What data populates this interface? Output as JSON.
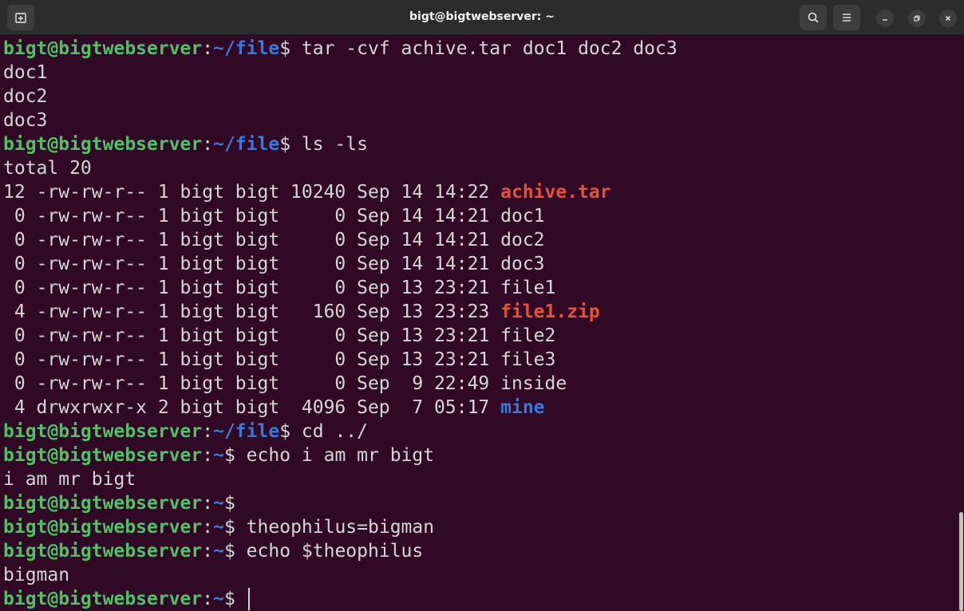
{
  "window": {
    "title": "bigt@bigtwebserver: ~",
    "new_tab_icon": "new-tab-icon",
    "search_icon": "search-icon",
    "menu_icon": "hamburger-menu-icon",
    "minimize_icon": "minimize-icon",
    "restore_icon": "restore-icon",
    "close_icon": "close-icon"
  },
  "colors": {
    "background": "#300a24",
    "prompt_user": "#4ec266",
    "prompt_path": "#3579dc",
    "archive": "#e8503a",
    "directory": "#3579dc",
    "text": "#d5d5d5"
  },
  "prompt": {
    "user": "bigt@bigtwebserver",
    "colon": ":",
    "path_file": "~/file",
    "path_home": "~",
    "dollar": "$"
  },
  "terminal": {
    "cmd1": " tar -cvf achive.tar doc1 doc2 doc3",
    "out1": "doc1",
    "out2": "doc2",
    "out3": "doc3",
    "cmd2": " ls -ls",
    "total": "total 20",
    "ls_rows": [
      {
        "meta": "12 -rw-rw-r-- 1 bigt bigt 10240 Sep 14 14:22 ",
        "name": "achive.tar",
        "kind": "archive"
      },
      {
        "meta": " 0 -rw-rw-r-- 1 bigt bigt     0 Sep 14 14:21 ",
        "name": "doc1",
        "kind": "file"
      },
      {
        "meta": " 0 -rw-rw-r-- 1 bigt bigt     0 Sep 14 14:21 ",
        "name": "doc2",
        "kind": "file"
      },
      {
        "meta": " 0 -rw-rw-r-- 1 bigt bigt     0 Sep 14 14:21 ",
        "name": "doc3",
        "kind": "file"
      },
      {
        "meta": " 0 -rw-rw-r-- 1 bigt bigt     0 Sep 13 23:21 ",
        "name": "file1",
        "kind": "file"
      },
      {
        "meta": " 4 -rw-rw-r-- 1 bigt bigt   160 Sep 13 23:23 ",
        "name": "file1.zip",
        "kind": "archive"
      },
      {
        "meta": " 0 -rw-rw-r-- 1 bigt bigt     0 Sep 13 23:21 ",
        "name": "file2",
        "kind": "file"
      },
      {
        "meta": " 0 -rw-rw-r-- 1 bigt bigt     0 Sep 13 23:21 ",
        "name": "file3",
        "kind": "file"
      },
      {
        "meta": " 0 -rw-rw-r-- 1 bigt bigt     0 Sep  9 22:49 ",
        "name": "inside",
        "kind": "file"
      },
      {
        "meta": " 4 drwxrwxr-x 2 bigt bigt  4096 Sep  7 05:17 ",
        "name": "mine",
        "kind": "directory"
      }
    ],
    "cmd3": " cd ../",
    "cmd4": " echo i am mr bigt",
    "out4": "i am mr bigt",
    "cmd5": "",
    "cmd6": " theophilus=bigman",
    "cmd7": " echo $theophilus",
    "out7": "bigman",
    "cmd8": " "
  }
}
